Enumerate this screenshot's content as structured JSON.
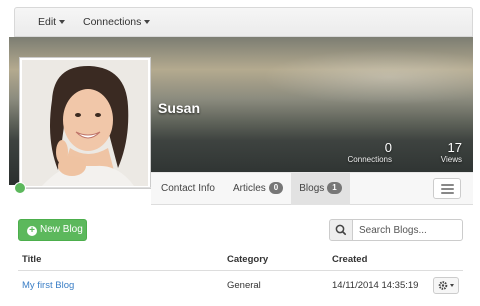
{
  "menu": {
    "edit": "Edit",
    "connections": "Connections"
  },
  "profile": {
    "name": "Susan"
  },
  "stats": {
    "connections": {
      "value": "0",
      "label": "Connections"
    },
    "views": {
      "value": "17",
      "label": "Views"
    }
  },
  "tabs": [
    {
      "label": "Contact Info"
    },
    {
      "label": "Articles",
      "count": "0"
    },
    {
      "label": "Blogs",
      "count": "1",
      "active": true
    }
  ],
  "toolbar": {
    "new_blog": "New Blog",
    "search_placeholder": "Search Blogs..."
  },
  "table": {
    "headers": {
      "title": "Title",
      "category": "Category",
      "created": "Created"
    },
    "rows": [
      {
        "title": "My first Blog",
        "category": "General",
        "created": "14/11/2014 14:35:19"
      }
    ]
  },
  "colors": {
    "primary_green": "#5cb85c",
    "link_blue": "#3a7ec6",
    "status": "online"
  },
  "icons": [
    "caret-down-icon",
    "plus-circle-icon",
    "search-icon",
    "menu-icon",
    "gear-icon"
  ]
}
